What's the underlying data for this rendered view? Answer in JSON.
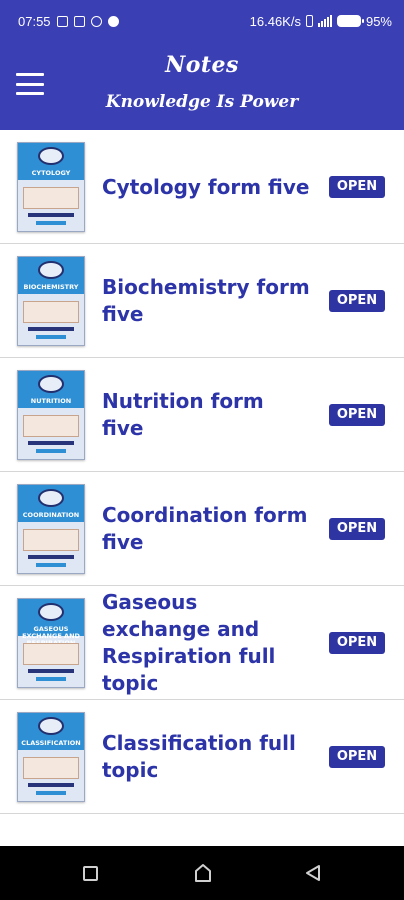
{
  "status_bar": {
    "time": "07:55",
    "speed": "16.46K/s",
    "battery": "95%",
    "battery_level": 0.95,
    "left_icons": [
      "gallery-icon",
      "image-icon",
      "record-icon",
      "whatsapp-icon"
    ],
    "right_icons": [
      "phone-vibrate-icon",
      "signal-icon",
      "battery-icon"
    ]
  },
  "app_bar": {
    "title": "Notes",
    "subtitle": "Knowledge Is Power",
    "menu_icon": "hamburger-menu-icon",
    "color": "#3b3fb4"
  },
  "notes": [
    {
      "title": "Cytology form five",
      "cover_label": "CYTOLOGY",
      "button": "OPEN"
    },
    {
      "title": "Biochemistry form five",
      "cover_label": "BIOCHEMISTRY",
      "button": "OPEN"
    },
    {
      "title": "Nutrition form five",
      "cover_label": "NUTRITION",
      "button": "OPEN"
    },
    {
      "title": "Coordination form five",
      "cover_label": "COORDINATION",
      "button": "OPEN"
    },
    {
      "title": "Gaseous exchange and Respiration full topic",
      "cover_label": "GASEOUS EXCHANGE AND RESPIRATION",
      "button": "OPEN"
    },
    {
      "title": "Classification full topic",
      "cover_label": "CLASSIFICATION",
      "button": "OPEN"
    }
  ],
  "colors": {
    "accent": "#2c34a8",
    "button": "#2f34a3"
  },
  "nav_bar": {
    "icons": [
      "recents-square-icon",
      "home-icon",
      "back-icon"
    ]
  }
}
